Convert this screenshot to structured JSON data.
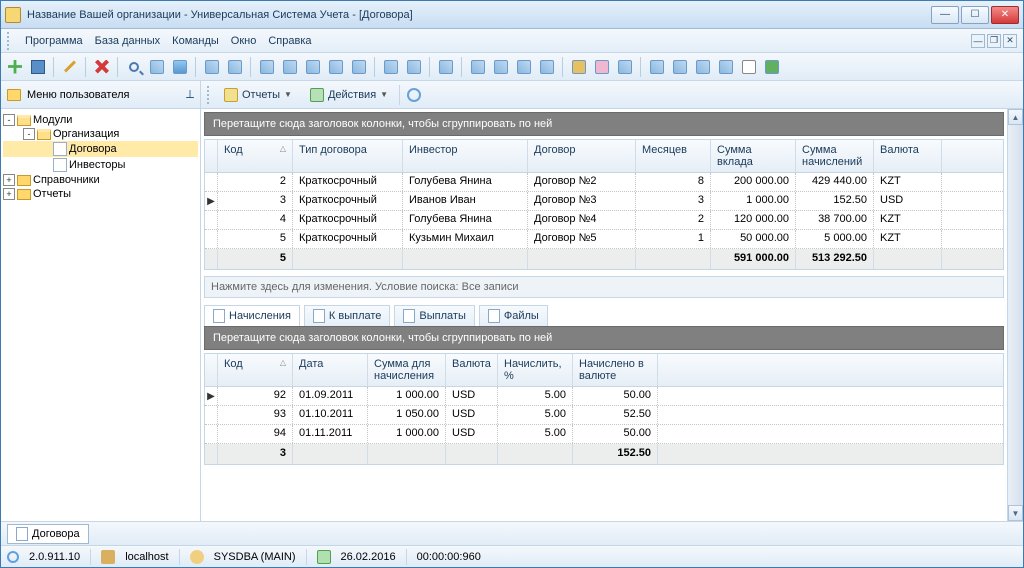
{
  "window": {
    "title": "Название Вашей организации - Универсальная Система Учета - [Договора]"
  },
  "menubar": {
    "items": [
      "Программа",
      "База данных",
      "Команды",
      "Окно",
      "Справка"
    ]
  },
  "sidebar": {
    "title": "Меню пользователя",
    "nodes": {
      "n0": {
        "label": "Модули",
        "tw": "-"
      },
      "n1": {
        "label": "Организация",
        "tw": "-"
      },
      "n2": {
        "label": "Договора"
      },
      "n3": {
        "label": "Инвесторы"
      },
      "n4": {
        "label": "Справочники",
        "tw": "+"
      },
      "n5": {
        "label": "Отчеты",
        "tw": "+"
      }
    }
  },
  "actions": {
    "reports": "Отчеты",
    "actions": "Действия"
  },
  "grid1": {
    "groupbar": "Перетащите сюда заголовок колонки, чтобы сгруппировать по ней",
    "headers": {
      "code": "Код",
      "type": "Тип договора",
      "investor": "Инвестор",
      "contract": "Договор",
      "months": "Месяцев",
      "deposit": "Сумма вклада",
      "accrual": "Сумма начислений",
      "currency": "Валюта"
    },
    "rows": [
      {
        "code": "2",
        "type": "Краткосрочный",
        "investor": "Голубева Янина",
        "contract": "Договор №2",
        "months": "8",
        "deposit": "200 000.00",
        "accrual": "429 440.00",
        "currency": "KZT"
      },
      {
        "code": "3",
        "type": "Краткосрочный",
        "investor": "Иванов Иван",
        "contract": "Договор №3",
        "months": "3",
        "deposit": "1 000.00",
        "accrual": "152.50",
        "currency": "USD"
      },
      {
        "code": "4",
        "type": "Краткосрочный",
        "investor": "Голубева Янина",
        "contract": "Договор №4",
        "months": "2",
        "deposit": "120 000.00",
        "accrual": "38 700.00",
        "currency": "KZT"
      },
      {
        "code": "5",
        "type": "Краткосрочный",
        "investor": "Кузьмин Михаил",
        "contract": "Договор №5",
        "months": "1",
        "deposit": "50 000.00",
        "accrual": "5 000.00",
        "currency": "KZT"
      }
    ],
    "summary": {
      "count": "5",
      "deposit": "591 000.00",
      "accrual": "513 292.50"
    },
    "filter": "Нажмите здесь для изменения. Условие поиска: Все записи"
  },
  "tabs": {
    "accruals": "Начисления",
    "topay": "К выплате",
    "payments": "Выплаты",
    "files": "Файлы"
  },
  "grid2": {
    "groupbar": "Перетащите сюда заголовок колонки, чтобы сгруппировать по ней",
    "headers": {
      "code": "Код",
      "date": "Дата",
      "sum": "Сумма для начисления",
      "currency": "Валюта",
      "pct": "Начислить, %",
      "accrued": "Начислено в валюте"
    },
    "rows": [
      {
        "code": "92",
        "date": "01.09.2011",
        "sum": "1 000.00",
        "currency": "USD",
        "pct": "5.00",
        "accrued": "50.00"
      },
      {
        "code": "93",
        "date": "01.10.2011",
        "sum": "1 050.00",
        "currency": "USD",
        "pct": "5.00",
        "accrued": "52.50"
      },
      {
        "code": "94",
        "date": "01.11.2011",
        "sum": "1 000.00",
        "currency": "USD",
        "pct": "5.00",
        "accrued": "50.00"
      }
    ],
    "summary": {
      "count": "3",
      "accrued": "152.50"
    }
  },
  "taskbar": {
    "tab": "Договора"
  },
  "status": {
    "version": "2.0.911.10",
    "host": "localhost",
    "user": "SYSDBA (MAIN)",
    "date": "26.02.2016",
    "time": "00:00:00:960"
  }
}
